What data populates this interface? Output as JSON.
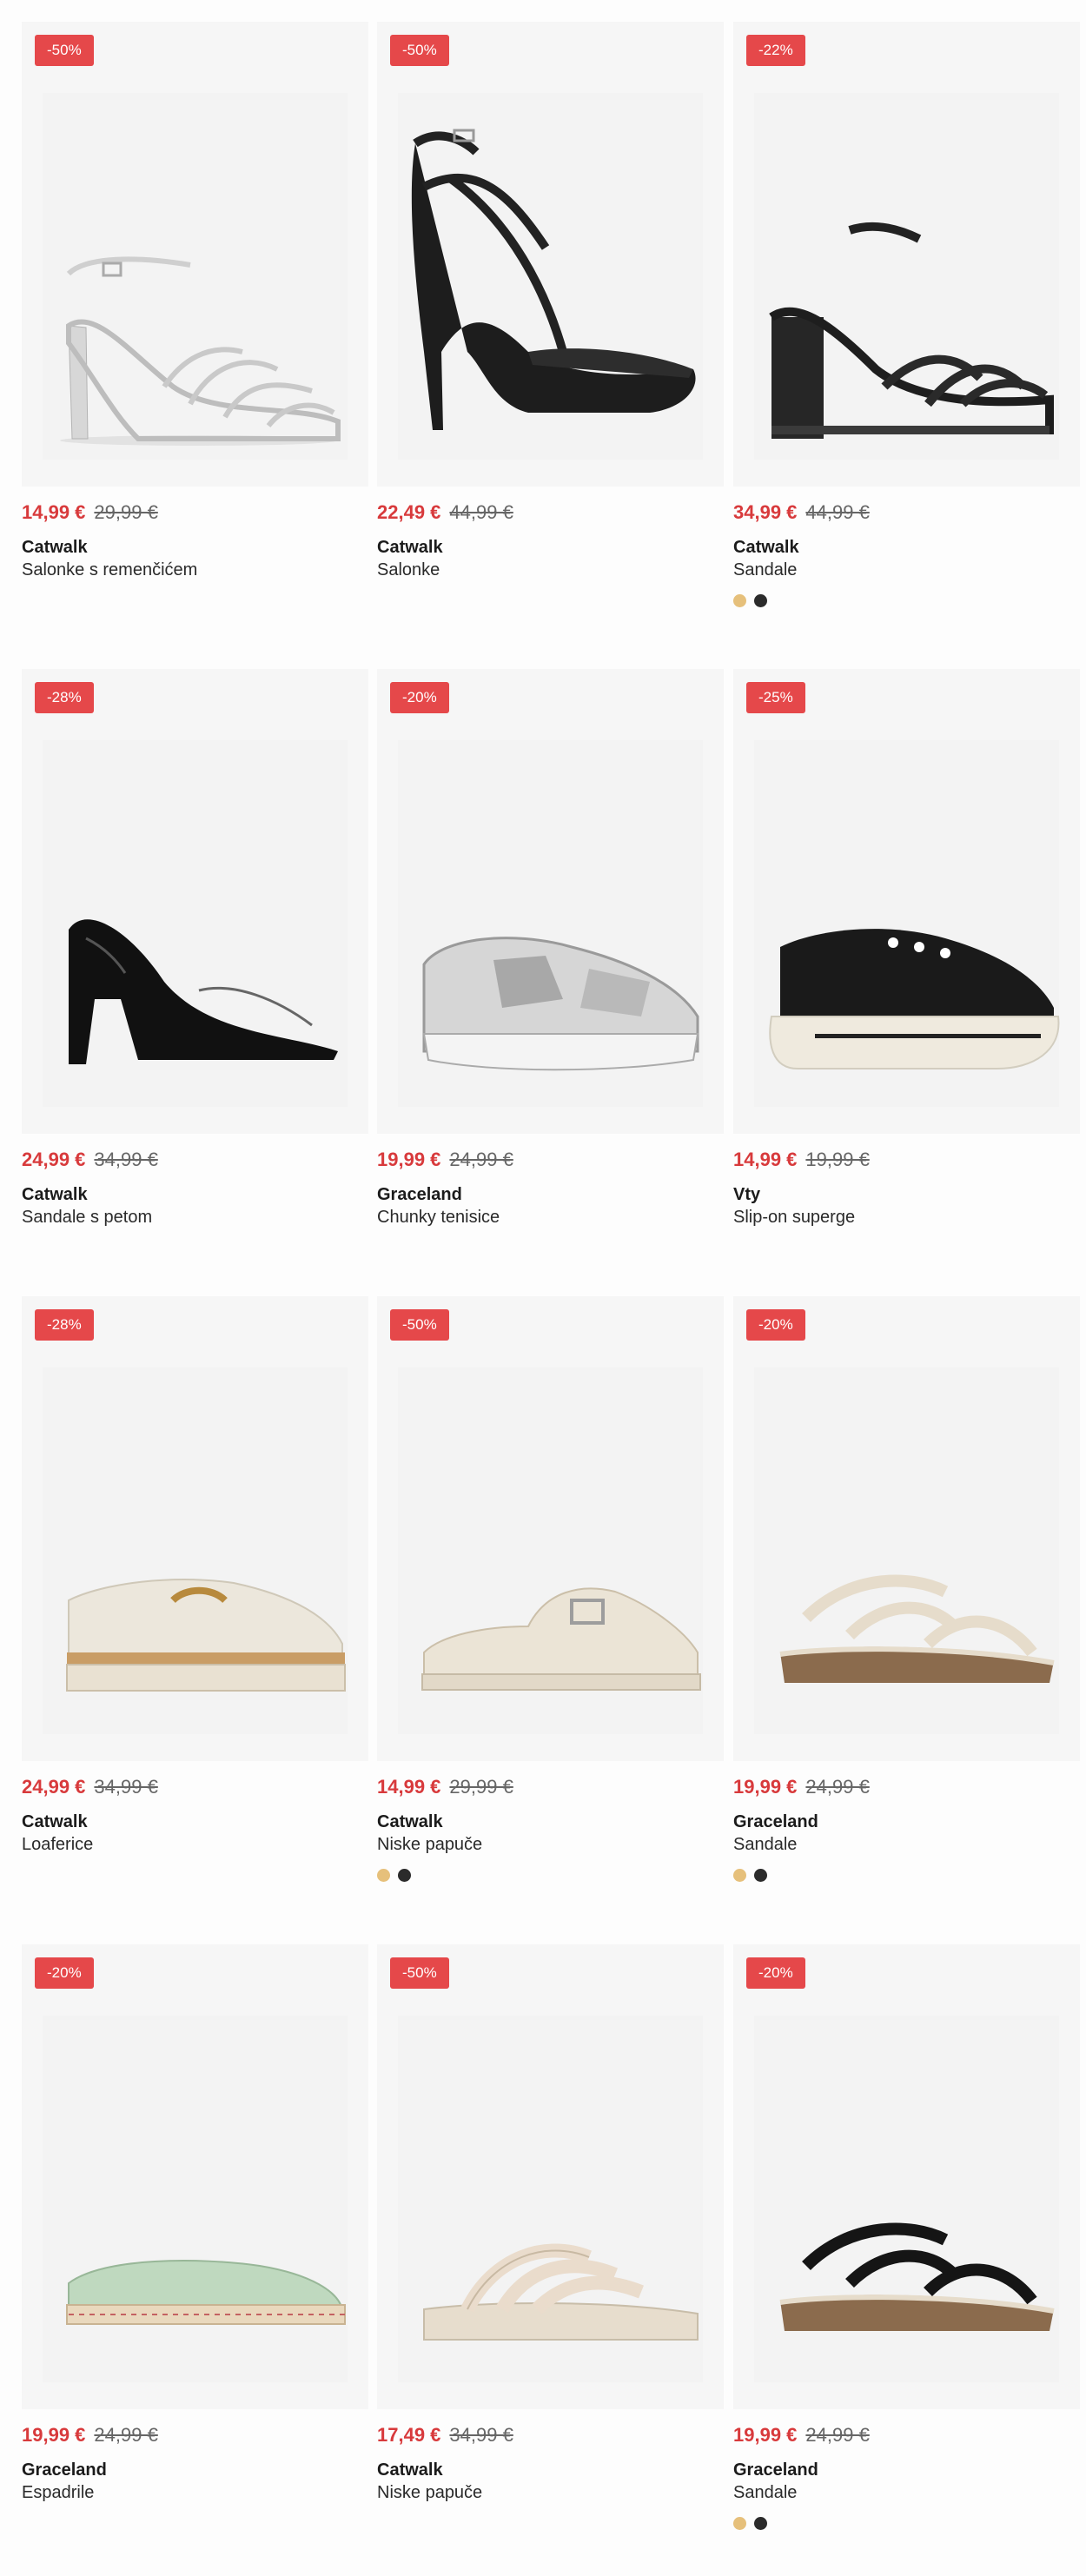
{
  "products": [
    {
      "badge": "-50%",
      "price": "14,99 €",
      "old_price": "29,99 €",
      "brand": "Catwalk",
      "name": "Salonke s remenčićem",
      "icon": "silver-strappy-heel-icon",
      "swatches": []
    },
    {
      "badge": "-50%",
      "price": "22,49 €",
      "old_price": "44,99 €",
      "brand": "Catwalk",
      "name": "Salonke",
      "icon": "black-platform-heel-icon",
      "swatches": []
    },
    {
      "badge": "-22%",
      "price": "34,99 €",
      "old_price": "44,99 €",
      "brand": "Catwalk",
      "name": "Sandale",
      "icon": "black-woven-block-sandal-icon",
      "swatches": [
        "#e6c07b",
        "#2b2b2b"
      ]
    },
    {
      "badge": "-28%",
      "price": "24,99 €",
      "old_price": "34,99 €",
      "brand": "Catwalk",
      "name": "Sandale s petom",
      "icon": "black-patent-pump-icon",
      "swatches": []
    },
    {
      "badge": "-20%",
      "price": "19,99 €",
      "old_price": "24,99 €",
      "brand": "Graceland",
      "name": "Chunky tenisice",
      "icon": "silver-chunky-sneaker-icon",
      "swatches": []
    },
    {
      "badge": "-25%",
      "price": "14,99 €",
      "old_price": "19,99 €",
      "brand": "Vty",
      "name": "Slip-on superge",
      "icon": "black-mesh-sneaker-icon",
      "swatches": []
    },
    {
      "badge": "-28%",
      "price": "24,99 €",
      "old_price": "34,99 €",
      "brand": "Catwalk",
      "name": "Loaferice",
      "icon": "cream-chain-loafer-icon",
      "swatches": []
    },
    {
      "badge": "-50%",
      "price": "14,99 €",
      "old_price": "29,99 €",
      "brand": "Catwalk",
      "name": "Niske papuče",
      "icon": "cream-buckle-mule-icon",
      "swatches": [
        "#e6c07b",
        "#2b2b2b"
      ]
    },
    {
      "badge": "-20%",
      "price": "19,99 €",
      "old_price": "24,99 €",
      "brand": "Graceland",
      "name": "Sandale",
      "icon": "beige-strap-sandal-icon",
      "swatches": [
        "#e6c07b",
        "#2b2b2b"
      ]
    },
    {
      "badge": "-20%",
      "price": "19,99 €",
      "old_price": "24,99 €",
      "brand": "Graceland",
      "name": "Espadrile",
      "icon": "mint-espadrille-icon",
      "swatches": []
    },
    {
      "badge": "-50%",
      "price": "17,49 €",
      "old_price": "34,99 €",
      "brand": "Catwalk",
      "name": "Niske papuče",
      "icon": "beige-strap-slide-icon",
      "swatches": []
    },
    {
      "badge": "-20%",
      "price": "19,99 €",
      "old_price": "24,99 €",
      "brand": "Graceland",
      "name": "Sandale",
      "icon": "black-strap-sandal-icon",
      "swatches": [
        "#e6c07b",
        "#2b2b2b"
      ]
    }
  ],
  "colors": {
    "badge_bg": "#e5484a",
    "price": "#d83a3c",
    "old_price": "#666666"
  }
}
